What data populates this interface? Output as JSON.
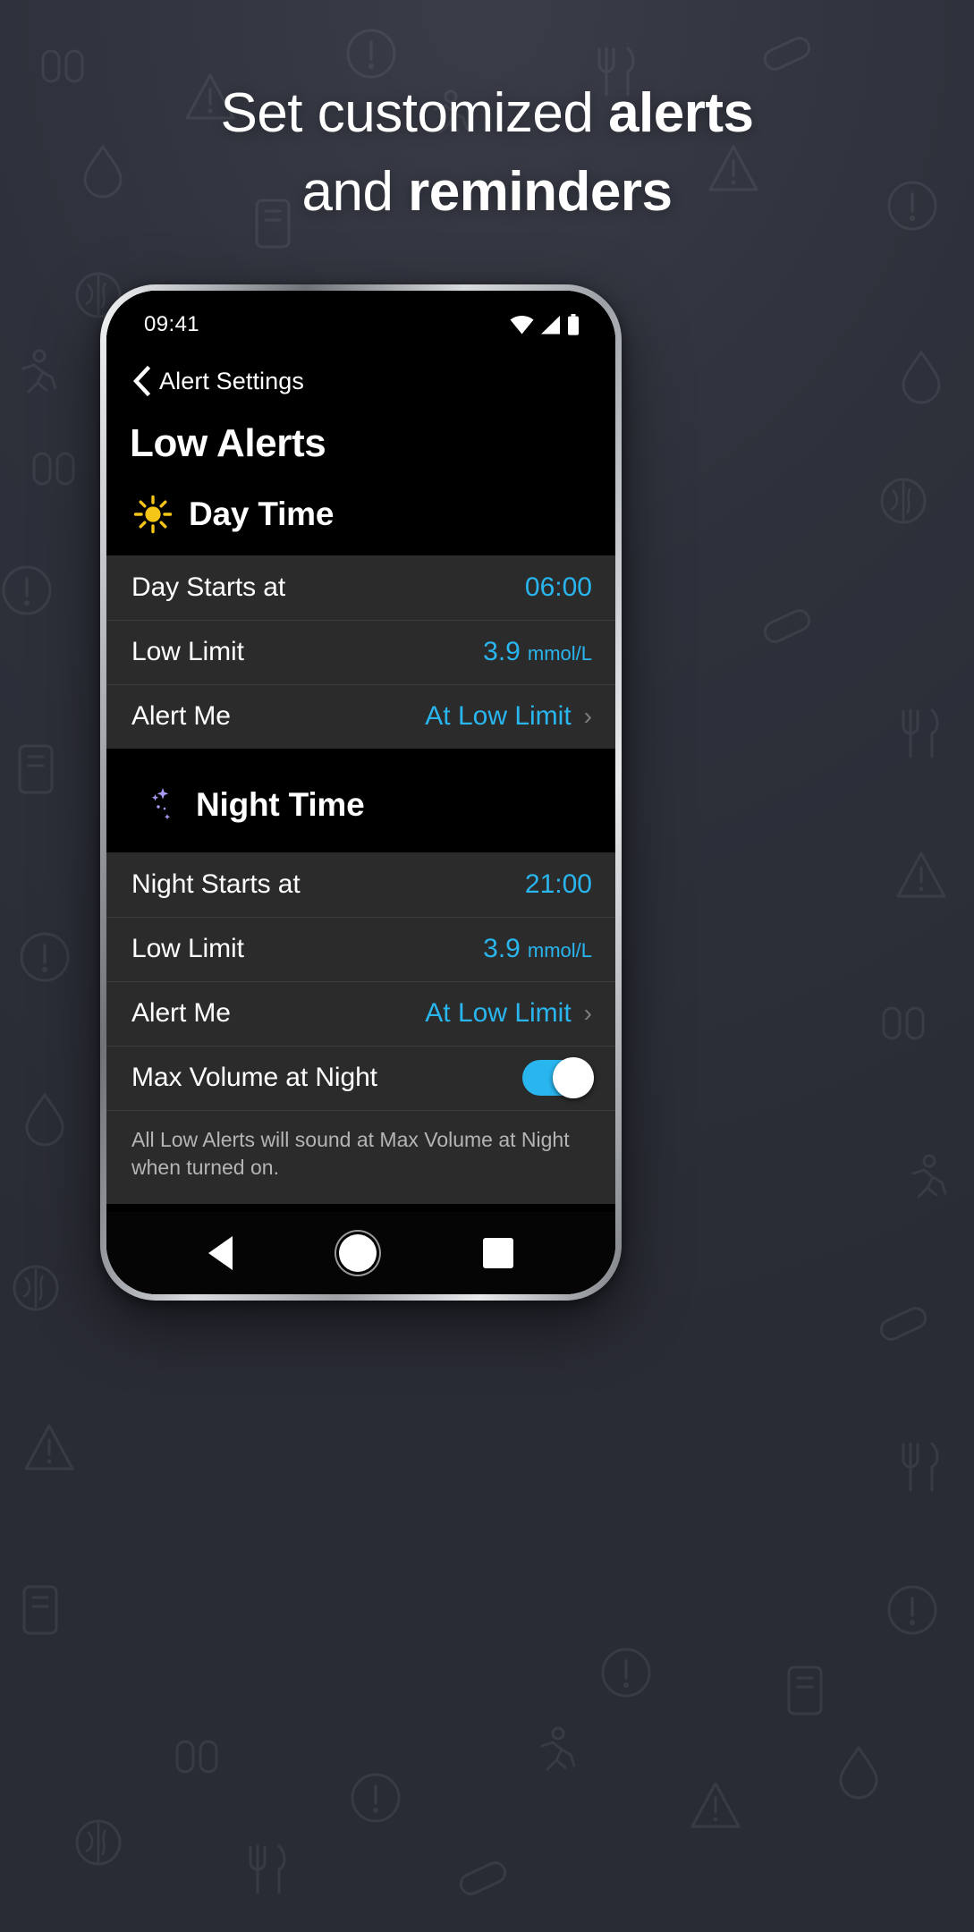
{
  "promo": {
    "line1_plain": "Set customized ",
    "line1_bold": "alerts",
    "line2_plain": "and ",
    "line2_bold": "reminders"
  },
  "status_bar": {
    "time": "09:41",
    "icons": [
      "wifi-icon",
      "cellular-signal-icon",
      "battery-icon"
    ]
  },
  "nav": {
    "back_label": "Alert Settings",
    "back_icon": "chevron-left-icon"
  },
  "page": {
    "title": "Low Alerts"
  },
  "day_section": {
    "icon": "sun-icon",
    "title": "Day Time",
    "rows": [
      {
        "label": "Day Starts at",
        "value": "06:00",
        "unit": "",
        "type": "value"
      },
      {
        "label": "Low Limit",
        "value": "3.9",
        "unit": "mmol/L",
        "type": "value"
      },
      {
        "label": "Alert Me",
        "value": "At Low Limit",
        "unit": "",
        "type": "link"
      }
    ]
  },
  "night_section": {
    "icon": "moon-stars-icon",
    "title": "Night Time",
    "rows": [
      {
        "label": "Night Starts at",
        "value": "21:00",
        "unit": "",
        "type": "value"
      },
      {
        "label": "Low Limit",
        "value": "3.9",
        "unit": "mmol/L",
        "type": "value"
      },
      {
        "label": "Alert Me",
        "value": "At Low Limit",
        "unit": "",
        "type": "link"
      },
      {
        "label": "Max Volume at Night",
        "value": "on",
        "unit": "",
        "type": "toggle"
      }
    ],
    "note": "All Low Alerts will sound at Max Volume at Night when turned on."
  },
  "android_nav": {
    "back": "nav-back-icon",
    "home": "nav-home-icon",
    "recents": "nav-recents-icon"
  },
  "colors": {
    "accent_cyan": "#29b6ef",
    "sun_yellow": "#f5c518",
    "moon_purple": "#a99bf5",
    "row_bg": "#2b2b2b",
    "screen_bg": "#000000",
    "page_bg": "#2e313b"
  }
}
